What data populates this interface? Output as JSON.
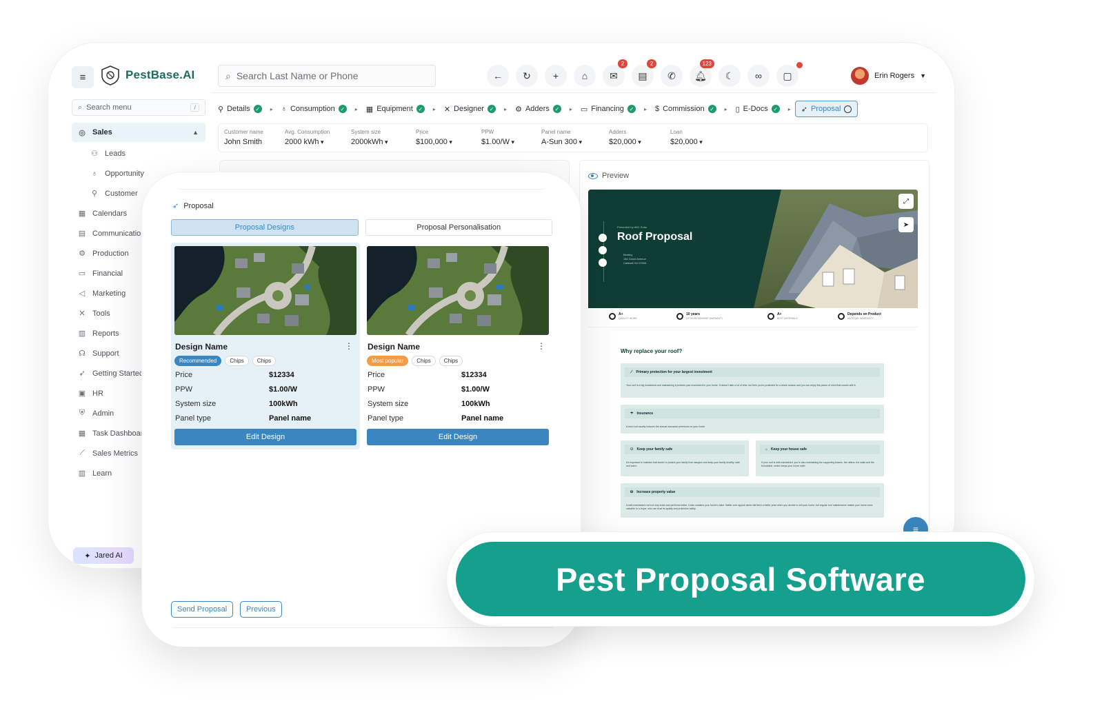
{
  "brand": {
    "name": "PestBase.AI"
  },
  "sidebar": {
    "search_placeholder": "Search menu",
    "search_shortcut": "/",
    "items": [
      {
        "label": "Sales",
        "icon": "target-icon",
        "glyph": "◎",
        "active": true
      },
      {
        "label": "Leads",
        "icon": "users-icon",
        "glyph": "⚇",
        "sub": true
      },
      {
        "label": "Opportunity",
        "icon": "lightbulb-icon",
        "glyph": "♁",
        "sub": true
      },
      {
        "label": "Customer",
        "icon": "user-check-icon",
        "glyph": "⚲",
        "sub": true
      },
      {
        "label": "Calendars",
        "icon": "calendar-icon",
        "glyph": "▦"
      },
      {
        "label": "Communicatio",
        "icon": "chat-icon",
        "glyph": "▤"
      },
      {
        "label": "Production",
        "icon": "gears-icon",
        "glyph": "⚙"
      },
      {
        "label": "Financial",
        "icon": "wallet-icon",
        "glyph": "▭"
      },
      {
        "label": "Marketing",
        "icon": "megaphone-icon",
        "glyph": "◁"
      },
      {
        "label": "Tools",
        "icon": "tools-icon",
        "glyph": "✕"
      },
      {
        "label": "Reports",
        "icon": "bar-chart-icon",
        "glyph": "▥"
      },
      {
        "label": "Support",
        "icon": "headset-icon",
        "glyph": "☊"
      },
      {
        "label": "Getting Startec",
        "icon": "rocket-icon",
        "glyph": "➶"
      },
      {
        "label": "HR",
        "icon": "id-card-icon",
        "glyph": "▣"
      },
      {
        "label": "Admin",
        "icon": "shield-user-icon",
        "glyph": "⛨"
      },
      {
        "label": "Task Dashboar",
        "icon": "dashboard-icon",
        "glyph": "▦"
      },
      {
        "label": "Sales Metrics",
        "icon": "line-chart-icon",
        "glyph": "⟋"
      },
      {
        "label": "Learn",
        "icon": "book-icon",
        "glyph": "▥"
      }
    ],
    "ai_button": "Jared AI"
  },
  "topbar": {
    "search_placeholder": "Search Last Name or Phone",
    "icons": [
      {
        "name": "back-arrow-icon",
        "glyph": "←"
      },
      {
        "name": "refresh-icon",
        "glyph": "↻"
      },
      {
        "name": "plus-icon",
        "glyph": "+"
      },
      {
        "name": "home-icon",
        "glyph": "⌂"
      },
      {
        "name": "mail-icon",
        "glyph": "✉",
        "badge": "2"
      },
      {
        "name": "message-icon",
        "glyph": "▤",
        "badge": "2"
      },
      {
        "name": "phone-icon",
        "glyph": "✆"
      },
      {
        "name": "bell-icon",
        "glyph": "🔔︎",
        "badge": "123"
      },
      {
        "name": "moon-icon",
        "glyph": "☾"
      },
      {
        "name": "glasses-icon",
        "glyph": "∞"
      },
      {
        "name": "window-icon",
        "glyph": "▢",
        "dot": true
      }
    ],
    "user_name": "Erin Rogers"
  },
  "steps": [
    {
      "label": "Details",
      "icon": "user-icon",
      "glyph": "⚲",
      "done": true
    },
    {
      "label": "Consumption",
      "icon": "bulb-icon",
      "glyph": "♁",
      "done": true
    },
    {
      "label": "Equipment",
      "icon": "grid-icon",
      "glyph": "▦",
      "done": true
    },
    {
      "label": "Designer",
      "icon": "tools-icon",
      "glyph": "✕",
      "done": true
    },
    {
      "label": "Adders",
      "icon": "gears-icon",
      "glyph": "⚙",
      "done": true
    },
    {
      "label": "Financing",
      "icon": "wallet-icon",
      "glyph": "▭",
      "done": true
    },
    {
      "label": "Commission",
      "icon": "dollar-icon",
      "glyph": "$",
      "done": true
    },
    {
      "label": "E-Docs",
      "icon": "document-icon",
      "glyph": "▯",
      "done": true
    },
    {
      "label": "Proposal",
      "icon": "rocket-icon",
      "glyph": "➶",
      "active": true
    }
  ],
  "summary": [
    {
      "label": "Customer name",
      "value": "John Smith",
      "dropdown": false
    },
    {
      "label": "Avg. Consumption",
      "value": "2000 kWh",
      "dropdown": true
    },
    {
      "label": "System size",
      "value": "2000kWh",
      "dropdown": true
    },
    {
      "label": "Price",
      "value": "$100,000",
      "dropdown": true
    },
    {
      "label": "PPW",
      "value": "$1.00/W",
      "dropdown": true
    },
    {
      "label": "Panel name",
      "value": "A-Sun 300",
      "dropdown": true
    },
    {
      "label": "Adders",
      "value": "$20,000",
      "dropdown": true
    },
    {
      "label": "Loan",
      "value": "$20,000",
      "dropdown": true
    }
  ],
  "preview": {
    "label": "Preview",
    "hero": {
      "small_text": "Presented by ABC Solar",
      "title": "Roof Proposal",
      "address_lines": [
        "Bentley",
        "184 Gould Avenue",
        "Caldwell NJ 07006"
      ]
    },
    "features": [
      {
        "title": "A+",
        "sub": "QUALITY WORK"
      },
      {
        "title": "10 years",
        "sub": "OF WORKMANSHIP WARRANTY"
      },
      {
        "title": "A+",
        "sub": "BEST MATERIALS"
      },
      {
        "title": "Depends on Product",
        "sub": "MATERIAL WARRANTY"
      }
    ],
    "section_title": "Why replace your roof?",
    "cards": [
      {
        "title": "Primary protection for your largest investment",
        "text": "Your roof is a big investment and maintaining it protects your investment in your home. It doesn't take a lot of time, but then you're protected for a whole season and you can enjoy the peace of mind that comes with it."
      },
      {
        "title": "Insurance",
        "text": "A new roof usually reduces the annual insurance premiums on your home."
      },
      {
        "title": "Keep your family safe",
        "text": "It's important to maintain that barrier to protect your family from dangers and keep your family healthy, safe and warm."
      },
      {
        "title": "Keep your house safe",
        "text": "If your roof is well-maintained, you're also maintaining the supporting beams, the rafters, the walls and the foundation, which keeps your home safer."
      },
      {
        "title": "Increase property value",
        "text": "A well-maintained roof not only looks and performs better, it also sustains your home's value. Better curb appeal alone will fetch a better price when you decide to sell your home, but regular roof maintenance makes your home more valuable to a buyer, who can trust its quality and protective ability."
      }
    ]
  },
  "proposal": {
    "title": "Proposal",
    "tabs": [
      "Proposal Designs",
      "Proposal Personalisation"
    ],
    "designs": [
      {
        "name": "Design Name",
        "chips": [
          "Recommended",
          "Chips",
          "Chips"
        ],
        "specs": [
          {
            "k": "Price",
            "v": "$12334"
          },
          {
            "k": "PPW",
            "v": "$1.00/W"
          },
          {
            "k": "System size",
            "v": "100kWh"
          },
          {
            "k": "Panel type",
            "v": "Panel name"
          }
        ],
        "button": "Edit Design"
      },
      {
        "name": "Design Name",
        "chips": [
          "Most popular",
          "Chips",
          "Chips"
        ],
        "specs": [
          {
            "k": "Price",
            "v": "$12334"
          },
          {
            "k": "PPW",
            "v": "$1.00/W"
          },
          {
            "k": "System size",
            "v": "100kWh"
          },
          {
            "k": "Panel type",
            "v": "Panel name"
          }
        ],
        "button": "Edit Design"
      }
    ],
    "send_button": "Send Proposal",
    "previous_button": "Previous"
  },
  "banner": {
    "text": "Pest Proposal Software"
  },
  "colors": {
    "accent": "#3a86c0",
    "brand_green": "#14a08c",
    "hero_bg": "#0f3d36",
    "check": "#1e9b6b"
  }
}
